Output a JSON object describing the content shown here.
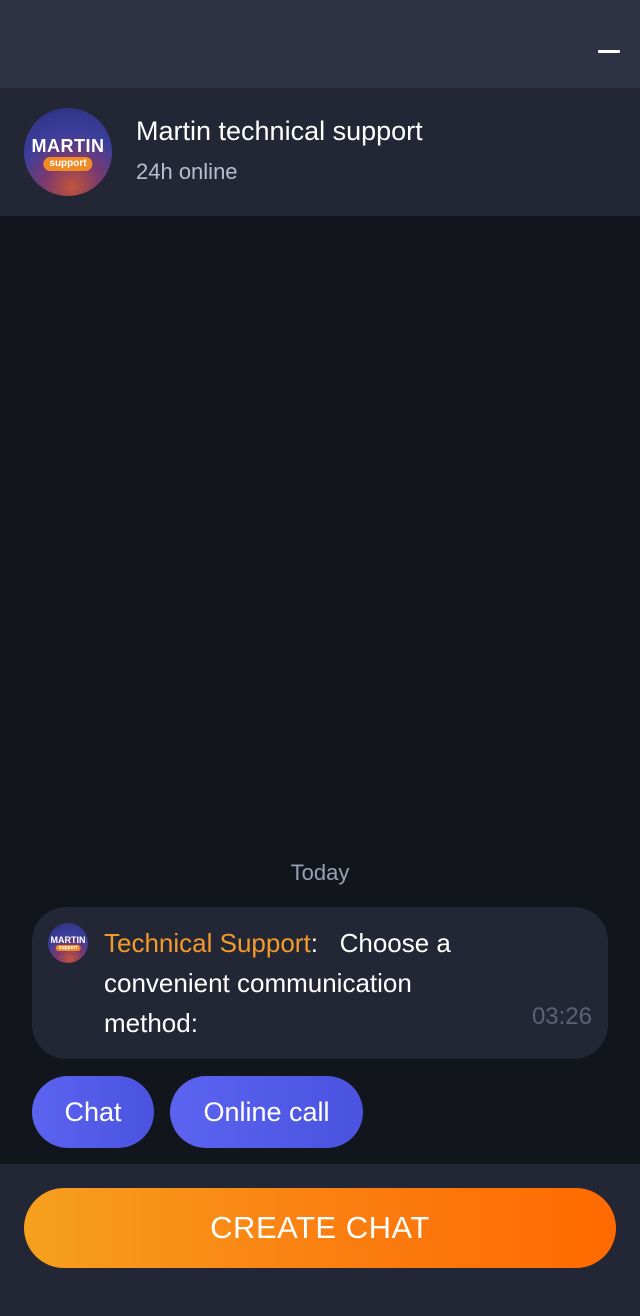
{
  "header": {
    "title": "Martin technical support",
    "status": "24h online",
    "logo": {
      "brand": "MARTIN",
      "pill": "support"
    }
  },
  "icons": {
    "minimize": "minimize-icon"
  },
  "chat": {
    "date_label": "Today",
    "message": {
      "sender": "Technical Support",
      "separator": ":",
      "text": "Choose a convenient communication method:",
      "time": "03:26",
      "avatar_logo": {
        "brand": "MARTIN",
        "pill": "support"
      }
    },
    "options": [
      {
        "label": "Chat"
      },
      {
        "label": "Online call"
      }
    ]
  },
  "footer": {
    "create_label": "CREATE CHAT"
  },
  "colors": {
    "accent_orange": "#f39a2c",
    "option_blue": "#5b63f0",
    "button_gradient_start": "#f6a01e",
    "button_gradient_end": "#ff6a00",
    "background": "#13151c",
    "panel": "#232634"
  }
}
